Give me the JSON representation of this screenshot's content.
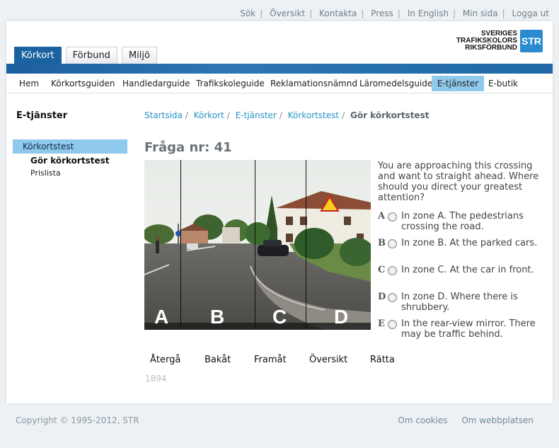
{
  "top_links": [
    "Sök",
    "Översikt",
    "Kontakta",
    "Press",
    "In English",
    "Min sida",
    "Logga ut"
  ],
  "tabs": [
    {
      "label": "Körkort",
      "active": true
    },
    {
      "label": "Förbund",
      "active": false
    },
    {
      "label": "Miljö",
      "active": false
    }
  ],
  "logo": {
    "line1": "SVERIGES",
    "line2": "TRAFIKSKOLORS",
    "line3": "RIKSFÖRBUND",
    "badge": "STR",
    "badge_color": "#2a8bd0"
  },
  "nav": [
    {
      "label": "Hem",
      "active": false
    },
    {
      "label": "Körkortsguiden",
      "active": false
    },
    {
      "label": "Handledarguide",
      "active": false
    },
    {
      "label": "Trafikskoleguide",
      "active": false
    },
    {
      "label": "Reklamationsnämnd",
      "active": false
    },
    {
      "label": "Läromedelsguide",
      "active": false
    },
    {
      "label": "E-tjänster",
      "active": true
    },
    {
      "label": "E-butik",
      "active": false
    }
  ],
  "sidebar": {
    "title": "E-tjänster",
    "active_item": "Körkortstest",
    "sub_items": [
      "Gör körkortstest",
      "Prislista"
    ]
  },
  "breadcrumb": {
    "items": [
      "Startsida",
      "Körkort",
      "E-tjänster",
      "Körkortstest"
    ],
    "current": "Gör körkortstest"
  },
  "question": {
    "title": "Fråga nr: 41",
    "text": "You are approaching this crossing and want to straight ahead. Where should you direct your greatest attention?",
    "zones": [
      "A",
      "B",
      "C",
      "D"
    ],
    "answers": [
      {
        "letter": "A",
        "text": "In zone A. The pedestrians crossing the road."
      },
      {
        "letter": "B",
        "text": "In zone B. At the parked cars."
      },
      {
        "letter": "C",
        "text": "In zone C. At the car in front."
      },
      {
        "letter": "D",
        "text": "In zone D. Where there is shrubbery."
      },
      {
        "letter": "E",
        "text": "In the rear-view mirror. There may be traffic behind."
      }
    ],
    "id": "1894"
  },
  "actions": [
    "Återgå",
    "Bakåt",
    "Framåt",
    "Översikt",
    "Rätta"
  ],
  "footer": {
    "copyright": "Copyright © 1995-2012, STR",
    "links": [
      "Om cookies",
      "Om webbplatsen"
    ]
  },
  "colors": {
    "accent_blue": "#1a63a0",
    "highlight": "#8fc9ec",
    "link": "#2a93c7"
  }
}
